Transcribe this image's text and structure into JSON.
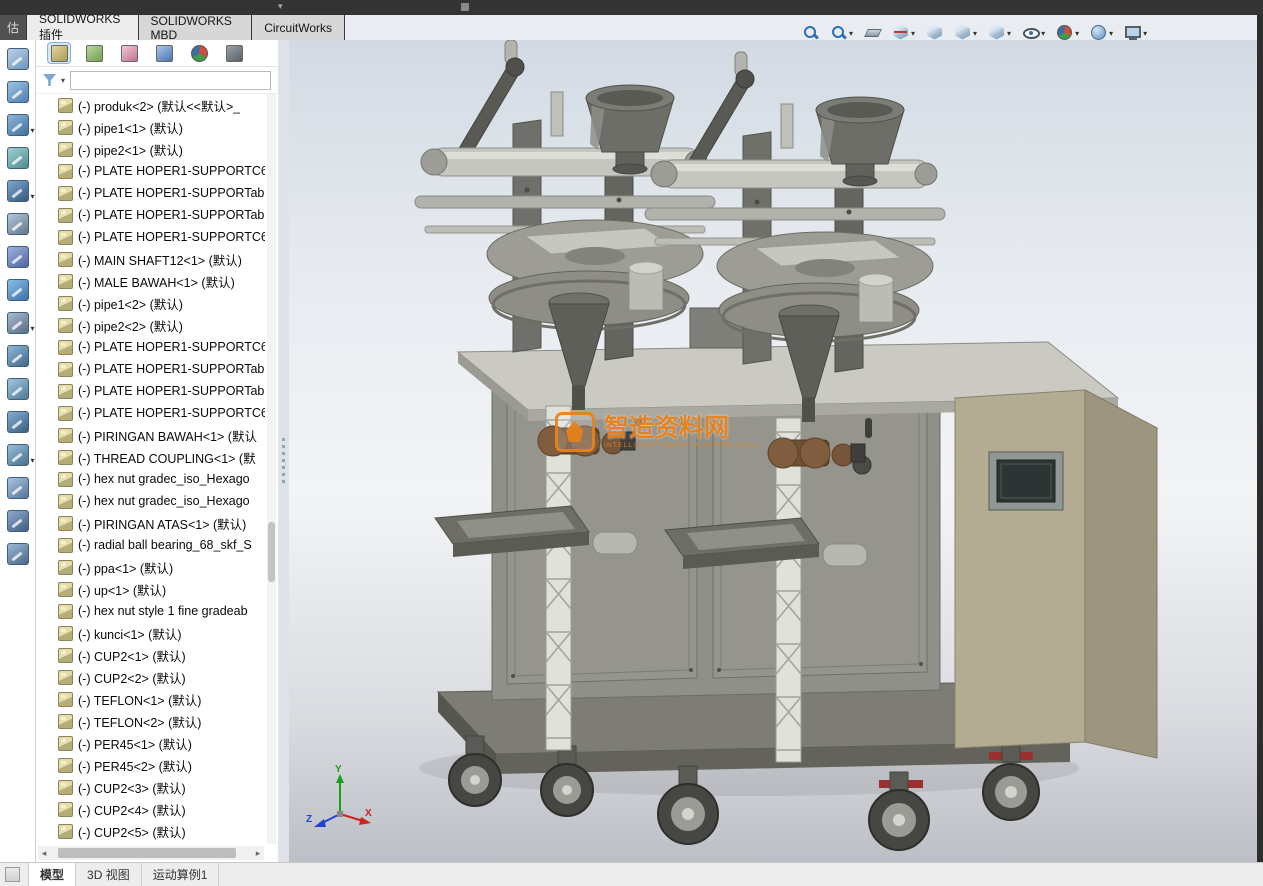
{
  "chrome": {
    "partial_tab": "估",
    "title_caret": "▾"
  },
  "command_tabs": {
    "items": [
      {
        "key": "solidworks-addins",
        "label": "SOLIDWORKS 插件",
        "active": true
      },
      {
        "key": "solidworks-mbd",
        "label": "SOLIDWORKS MBD",
        "active": false
      },
      {
        "key": "circuitworks",
        "label": "CircuitWorks",
        "active": false
      }
    ]
  },
  "left_toolbar": {
    "items": [
      {
        "name": "select-icon",
        "c1": "#bcd2e8",
        "c2": "#6f94b8"
      },
      {
        "name": "sketch-icon",
        "c1": "#9fc4e4",
        "c2": "#4f7fae"
      },
      {
        "name": "features-icon",
        "c1": "#8fb6da",
        "c2": "#42709e",
        "caret": true
      },
      {
        "name": "surfaces-icon",
        "c1": "#9fd0d0",
        "c2": "#4f8f8f"
      },
      {
        "name": "assembly-icon",
        "c1": "#7ea7cf",
        "c2": "#35597f",
        "caret": true
      },
      {
        "name": "drawing-icon",
        "c1": "#b4c8dc",
        "c2": "#64788c"
      },
      {
        "name": "camera-icon",
        "c1": "#9fb4e0",
        "c2": "#4f64a0"
      },
      {
        "name": "rotate-view-icon",
        "c1": "#8cc0e8",
        "c2": "#3c70a8"
      },
      {
        "name": "pan-icon",
        "c1": "#a8bcd4",
        "c2": "#586c84",
        "caret": true
      },
      {
        "name": "measure-icon",
        "c1": "#90b8d8",
        "c2": "#406888"
      },
      {
        "name": "mass-properties-icon",
        "c1": "#a0c8e0",
        "c2": "#507890"
      },
      {
        "name": "section-icon",
        "c1": "#88aed2",
        "c2": "#385e82"
      },
      {
        "name": "appearance-icon",
        "c1": "#98c0dc",
        "c2": "#48708c",
        "caret": true
      },
      {
        "name": "scene-icon",
        "c1": "#a8c4e4",
        "c2": "#587494"
      },
      {
        "name": "annotations-icon",
        "c1": "#90acd0",
        "c2": "#405c80"
      },
      {
        "name": "options-icon",
        "c1": "#9cb8d8",
        "c2": "#4c6888"
      }
    ]
  },
  "panel": {
    "tabs": [
      {
        "name": "featuremanager-tab",
        "c1": "#e2d49a",
        "c2": "#ad9a55",
        "active": true
      },
      {
        "name": "propertymanager-tab",
        "c1": "#bcd6a0",
        "c2": "#6f9f4f",
        "active": false
      },
      {
        "name": "configurationmanager-tab",
        "c1": "#f0c9d6",
        "c2": "#c07090",
        "active": false
      },
      {
        "name": "dimxpertmanager-tab",
        "c1": "#aac6ec",
        "c2": "#4a74b4",
        "active": false
      },
      {
        "name": "displaymanager-tab",
        "ball": true,
        "active": false
      },
      {
        "name": "addins-tab",
        "c1": "#9aa0a8",
        "c2": "#5a6068",
        "active": false
      }
    ],
    "filter": {
      "value": ""
    },
    "tree": {
      "items": [
        {
          "label": "(-) produk<2> (默认<<默认>_"
        },
        {
          "label": "(-) pipe1<1> (默认)"
        },
        {
          "label": "(-) pipe2<1> (默认)"
        },
        {
          "label": "(-) PLATE HOPER1-SUPPORTC6"
        },
        {
          "label": "(-) PLATE HOPER1-SUPPORTab"
        },
        {
          "label": "(-) PLATE HOPER1-SUPPORTab"
        },
        {
          "label": "(-) PLATE HOPER1-SUPPORTC6"
        },
        {
          "label": "(-) MAIN SHAFT12<1> (默认)"
        },
        {
          "label": "(-) MALE BAWAH<1> (默认)"
        },
        {
          "label": "(-) pipe1<2> (默认)"
        },
        {
          "label": "(-) pipe2<2> (默认)"
        },
        {
          "label": "(-) PLATE HOPER1-SUPPORTC6"
        },
        {
          "label": "(-) PLATE HOPER1-SUPPORTab"
        },
        {
          "label": "(-) PLATE HOPER1-SUPPORTab"
        },
        {
          "label": "(-) PLATE HOPER1-SUPPORTC6"
        },
        {
          "label": "(-) PIRINGAN BAWAH<1> (默认"
        },
        {
          "label": "(-) THREAD COUPLING<1> (默"
        },
        {
          "label": "(-) hex nut gradec_iso_Hexago"
        },
        {
          "label": "(-) hex nut gradec_iso_Hexago"
        },
        {
          "label": "(-) PIRINGAN ATAS<1> (默认)"
        },
        {
          "label": "(-) radial ball bearing_68_skf_S"
        },
        {
          "label": "(-) ppa<1> (默认)"
        },
        {
          "label": "(-) up<1> (默认)"
        },
        {
          "label": "(-) hex nut style 1 fine gradeab"
        },
        {
          "label": "(-) kunci<1> (默认)"
        },
        {
          "label": "(-) CUP2<1> (默认)"
        },
        {
          "label": "(-) CUP2<2> (默认)"
        },
        {
          "label": "(-) TEFLON<1> (默认)"
        },
        {
          "label": "(-) TEFLON<2> (默认)"
        },
        {
          "label": "(-) PER45<1> (默认)"
        },
        {
          "label": "(-) PER45<2> (默认)"
        },
        {
          "label": "(-) CUP2<3> (默认)"
        },
        {
          "label": "(-) CUP2<4> (默认)"
        },
        {
          "label": "(-) CUP2<5> (默认)"
        }
      ]
    }
  },
  "viewport": {
    "watermark": {
      "title": "智造资料网",
      "subtitle": "INTELLIGENT MANUFACTURING DATA",
      "color": "#e8831d"
    },
    "triad": {
      "x_label": "X",
      "y_label": "Y",
      "z_label": "Z",
      "x_color": "#cc2222",
      "y_color": "#18a018",
      "z_color": "#2244cc"
    }
  },
  "headsup": {
    "items": [
      {
        "name": "zoom-fit-icon",
        "type": "mag"
      },
      {
        "name": "zoom-area-icon",
        "type": "mag",
        "caret": true
      },
      {
        "name": "previous-view-icon",
        "type": "knife"
      },
      {
        "name": "section-view-icon",
        "type": "section",
        "caret": true
      },
      {
        "name": "annotation-view-icon",
        "type": "cube"
      },
      {
        "name": "view-orientation-icon",
        "type": "cube",
        "caret": true
      },
      {
        "name": "display-style-icon",
        "type": "cube",
        "caret": true
      },
      {
        "name": "hide-show-items-icon",
        "type": "eye",
        "caret": true
      },
      {
        "name": "edit-appearance-icon",
        "type": "ball",
        "caret": true
      },
      {
        "name": "apply-scene-icon",
        "type": "globe",
        "caret": true
      },
      {
        "name": "view-settings-icon",
        "type": "monitor",
        "caret": true
      }
    ]
  },
  "statusbar": {
    "tabs": [
      {
        "key": "model",
        "label": "模型",
        "active": true
      },
      {
        "key": "3d-view",
        "label": "3D 视图",
        "active": false
      },
      {
        "key": "motion-study1",
        "label": "运动算例1",
        "active": false
      }
    ]
  }
}
